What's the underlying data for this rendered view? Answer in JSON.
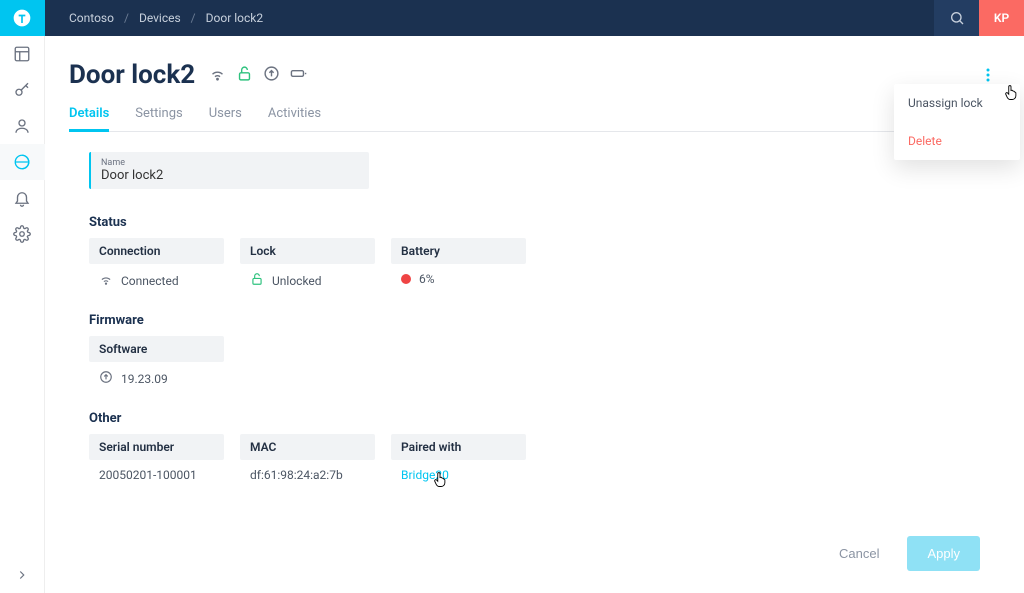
{
  "breadcrumbs": {
    "org": "Contoso",
    "section": "Devices",
    "item": "Door lock2"
  },
  "user_initials": "KP",
  "page_title": "Door lock2",
  "tabs": {
    "details": "Details",
    "settings": "Settings",
    "users": "Users",
    "activities": "Activities"
  },
  "name_field": {
    "label": "Name",
    "value": "Door lock2"
  },
  "sections": {
    "status": "Status",
    "firmware": "Firmware",
    "other": "Other"
  },
  "status": {
    "connection": {
      "label": "Connection",
      "value": "Connected",
      "icon": "wifi-icon"
    },
    "lock": {
      "label": "Lock",
      "value": "Unlocked",
      "icon": "lock-open-icon",
      "color": "#2ec27e"
    },
    "battery": {
      "label": "Battery",
      "value": "6%",
      "color": "#ef4444"
    }
  },
  "firmware": {
    "software": {
      "label": "Software",
      "value": "19.23.09",
      "icon": "update-icon"
    }
  },
  "other": {
    "serial": {
      "label": "Serial number",
      "value": "20050201-100001"
    },
    "mac": {
      "label": "MAC",
      "value": "df:61:98:24:a2:7b"
    },
    "paired": {
      "label": "Paired with",
      "value": "Bridge20"
    }
  },
  "buttons": {
    "cancel": "Cancel",
    "apply": "Apply"
  },
  "menu": {
    "unassign": "Unassign lock",
    "delete": "Delete"
  }
}
